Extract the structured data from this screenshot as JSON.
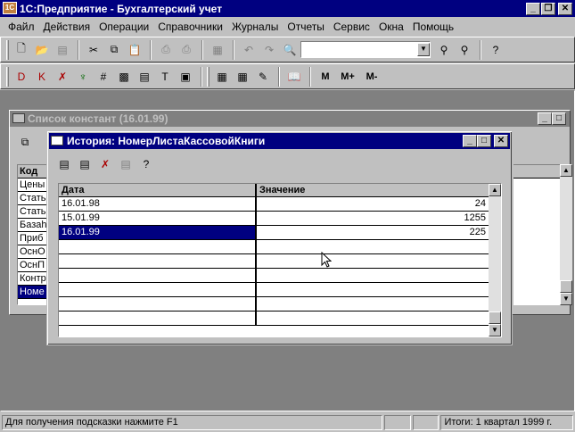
{
  "app": {
    "title": "1С:Предприятие - Бухгалтерский учет",
    "logo": "1С"
  },
  "menu": [
    "Файл",
    "Действия",
    "Операции",
    "Справочники",
    "Журналы",
    "Отчеты",
    "Сервис",
    "Окна",
    "Помощь"
  ],
  "toolbar2_text_buttons": [
    "M",
    "M+",
    "M-"
  ],
  "const_window": {
    "title": "Список констант (16.01.99)",
    "header": "Код",
    "rows": [
      "Цены",
      "Стать",
      "Стать",
      "Базаh",
      "Приб",
      "ОснО",
      "ОснП",
      "Контр",
      "Номе"
    ]
  },
  "history_window": {
    "title": "История: НомерЛистаКассовойКниги",
    "columns": [
      "Дата",
      "Значение"
    ],
    "rows": [
      {
        "date": "16.01.98",
        "value": "24"
      },
      {
        "date": "15.01.99",
        "value": "1255"
      },
      {
        "date": "16.01.99",
        "value": "225"
      }
    ]
  },
  "statusbar": {
    "hint": "Для получения подсказки нажмите F1",
    "period": "Итоги: 1 квартал 1999 г."
  },
  "colors": {
    "titlebar": "#000080",
    "face": "#c0c0c0",
    "workspace": "#808080",
    "selection": "#000080"
  }
}
